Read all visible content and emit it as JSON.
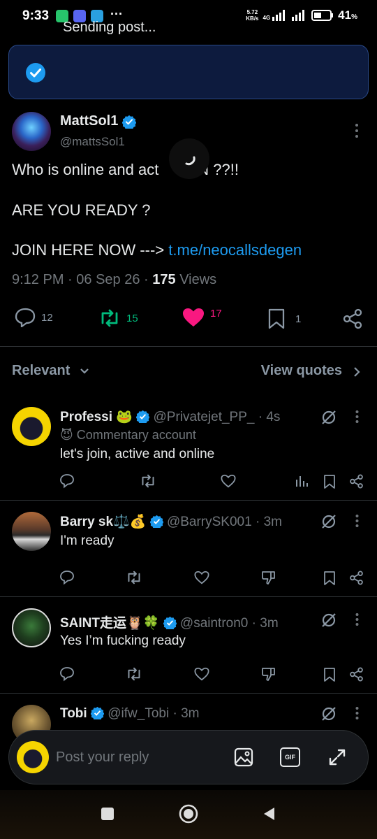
{
  "status_bar": {
    "time": "9:33",
    "net_speed_top": "5.72",
    "net_speed_bottom": "KB/s",
    "network_type": "4G",
    "battery": "41",
    "battery_unit": "%"
  },
  "toast": {
    "text": "Sending post..."
  },
  "post": {
    "author_name": "MattSol1",
    "author_handle": "@mattsSol1",
    "line1_before": "Who is online and act",
    "line1_after": "RN ??!!",
    "line2": "ARE YOU READY ?",
    "line3_prefix": "JOIN HERE NOW --->",
    "line3_link": "t.me/neocallsdegen",
    "time": "9:12 PM",
    "date": "06 Sep 26",
    "views_count": "175",
    "views_label": "Views",
    "replies": "12",
    "reposts": "15",
    "likes": "17",
    "bookmarks": "1"
  },
  "sort": {
    "relevant": "Relevant",
    "view_quotes": "View quotes"
  },
  "replies": [
    {
      "name": "Professi",
      "emoji": "🐸",
      "handle": "@Privatejet_PP_",
      "time": "4s",
      "commentary": "Commentary account",
      "text": "let's join, active and online"
    },
    {
      "name": "Barry sk",
      "emoji": "⚖️💰",
      "handle": "@BarrySK001",
      "time": "3m",
      "text": "I'm ready"
    },
    {
      "name": "SAINT走运",
      "emoji": "🦉🍀",
      "handle": "@saintron0",
      "time": "3m",
      "text": "Yes I’m fucking ready"
    },
    {
      "name": "Tobi",
      "handle": "@ifw_Tobi",
      "time": "3m"
    }
  ],
  "reply_bar": {
    "placeholder": "Post your reply",
    "gif": "GIF"
  },
  "colors": {
    "accent": "#1d9bf0",
    "like": "#f91880",
    "repost": "#00ba7c",
    "toast_bg": "#0d1b3e"
  }
}
